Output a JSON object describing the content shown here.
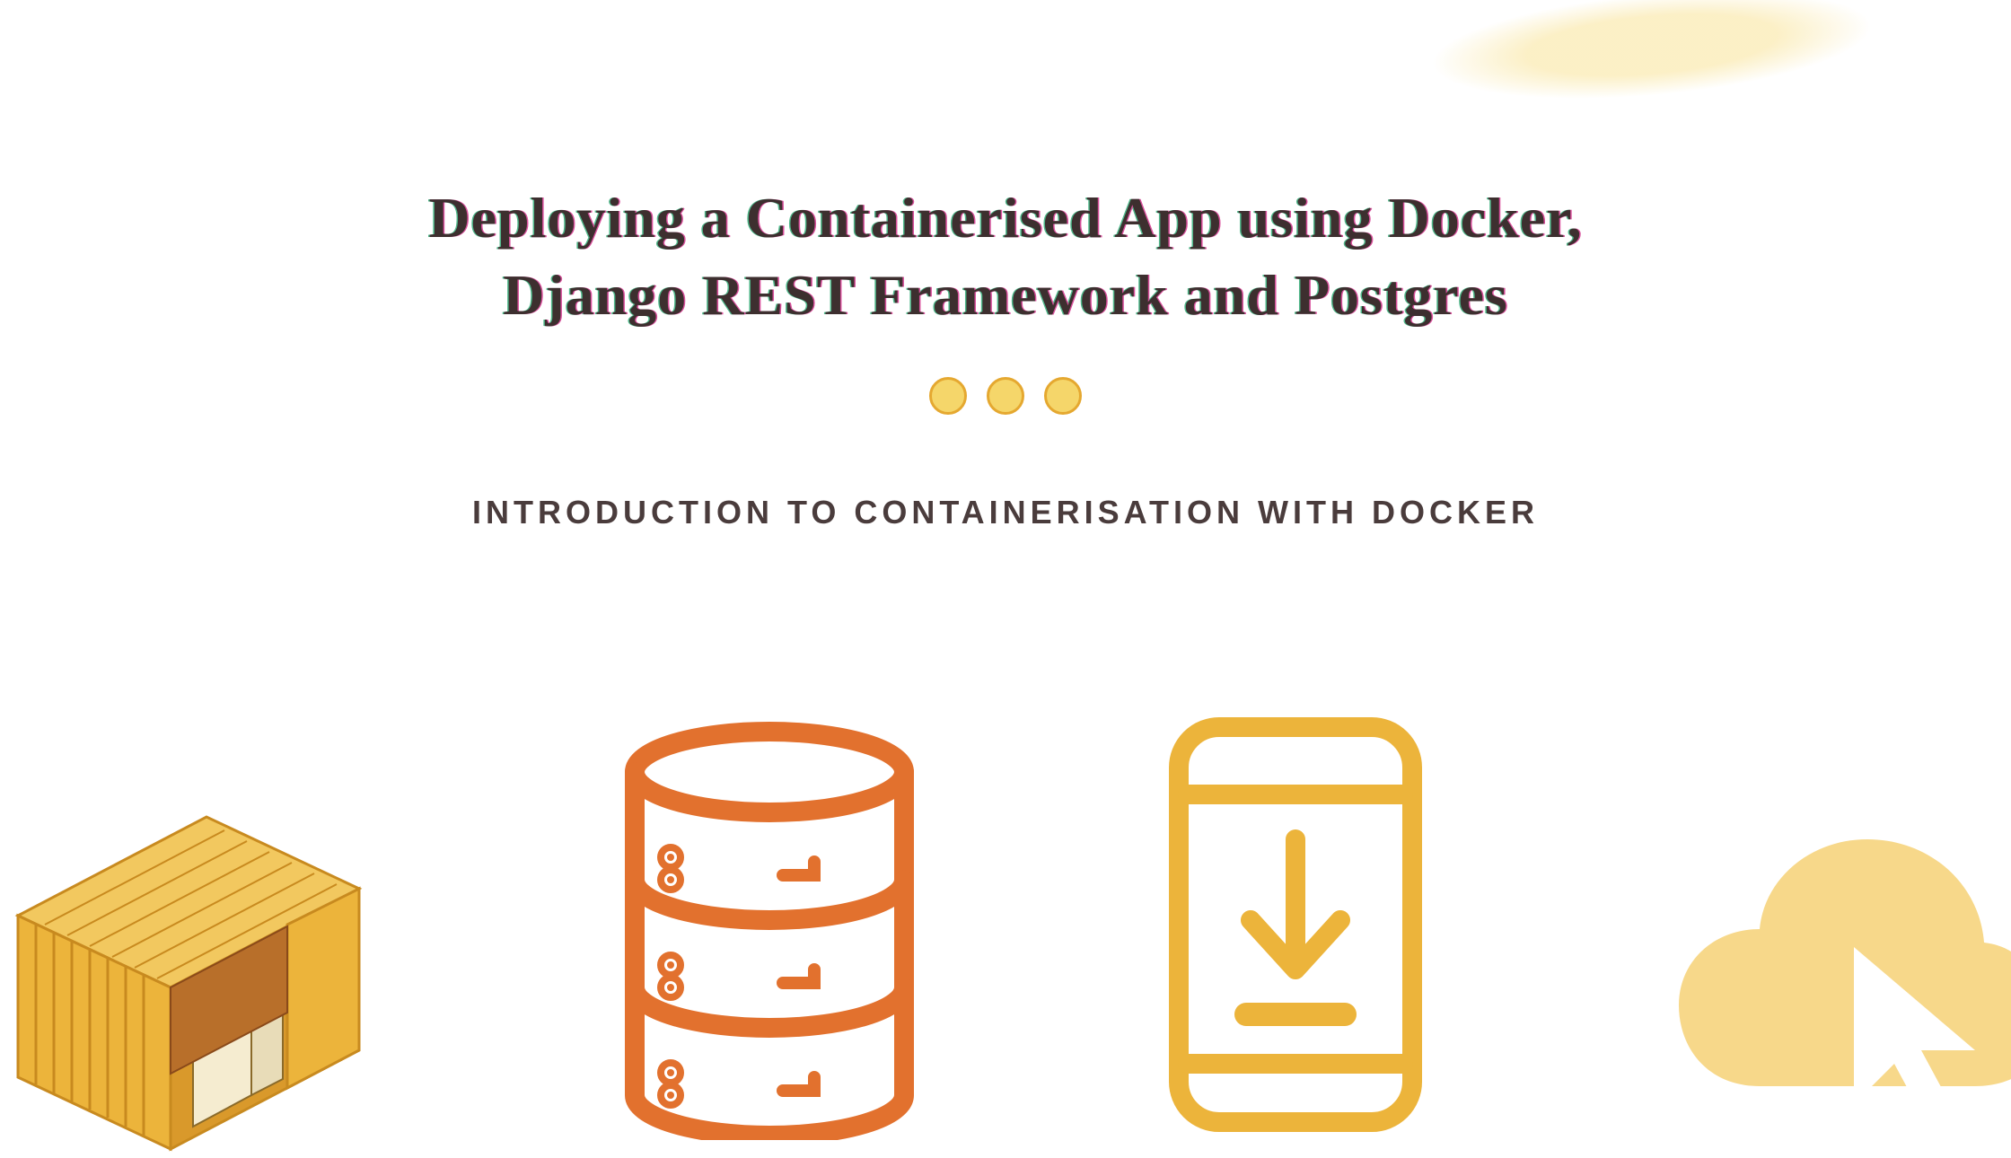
{
  "heading_line1": "Deploying a Containerised App using Docker,",
  "heading_line2": "Django REST Framework and Postgres",
  "subheading": "INTRODUCTION TO CONTAINERISATION WITH DOCKER",
  "colors": {
    "heading": "#3d2f2f",
    "subheading": "#4a3c3c",
    "dot_fill": "#f5d66a",
    "dot_border": "#e5a830",
    "brush": "#fbeec0",
    "database": "#e2712e",
    "phone": "#ecb43b",
    "cloud": "#f7d88a",
    "container_main": "#ecb43b",
    "container_dark": "#c88a1f"
  },
  "icons": {
    "container": "shipping-container-icon",
    "database": "database-icon",
    "phone": "phone-download-icon",
    "cloud": "cloud-cursor-icon"
  }
}
